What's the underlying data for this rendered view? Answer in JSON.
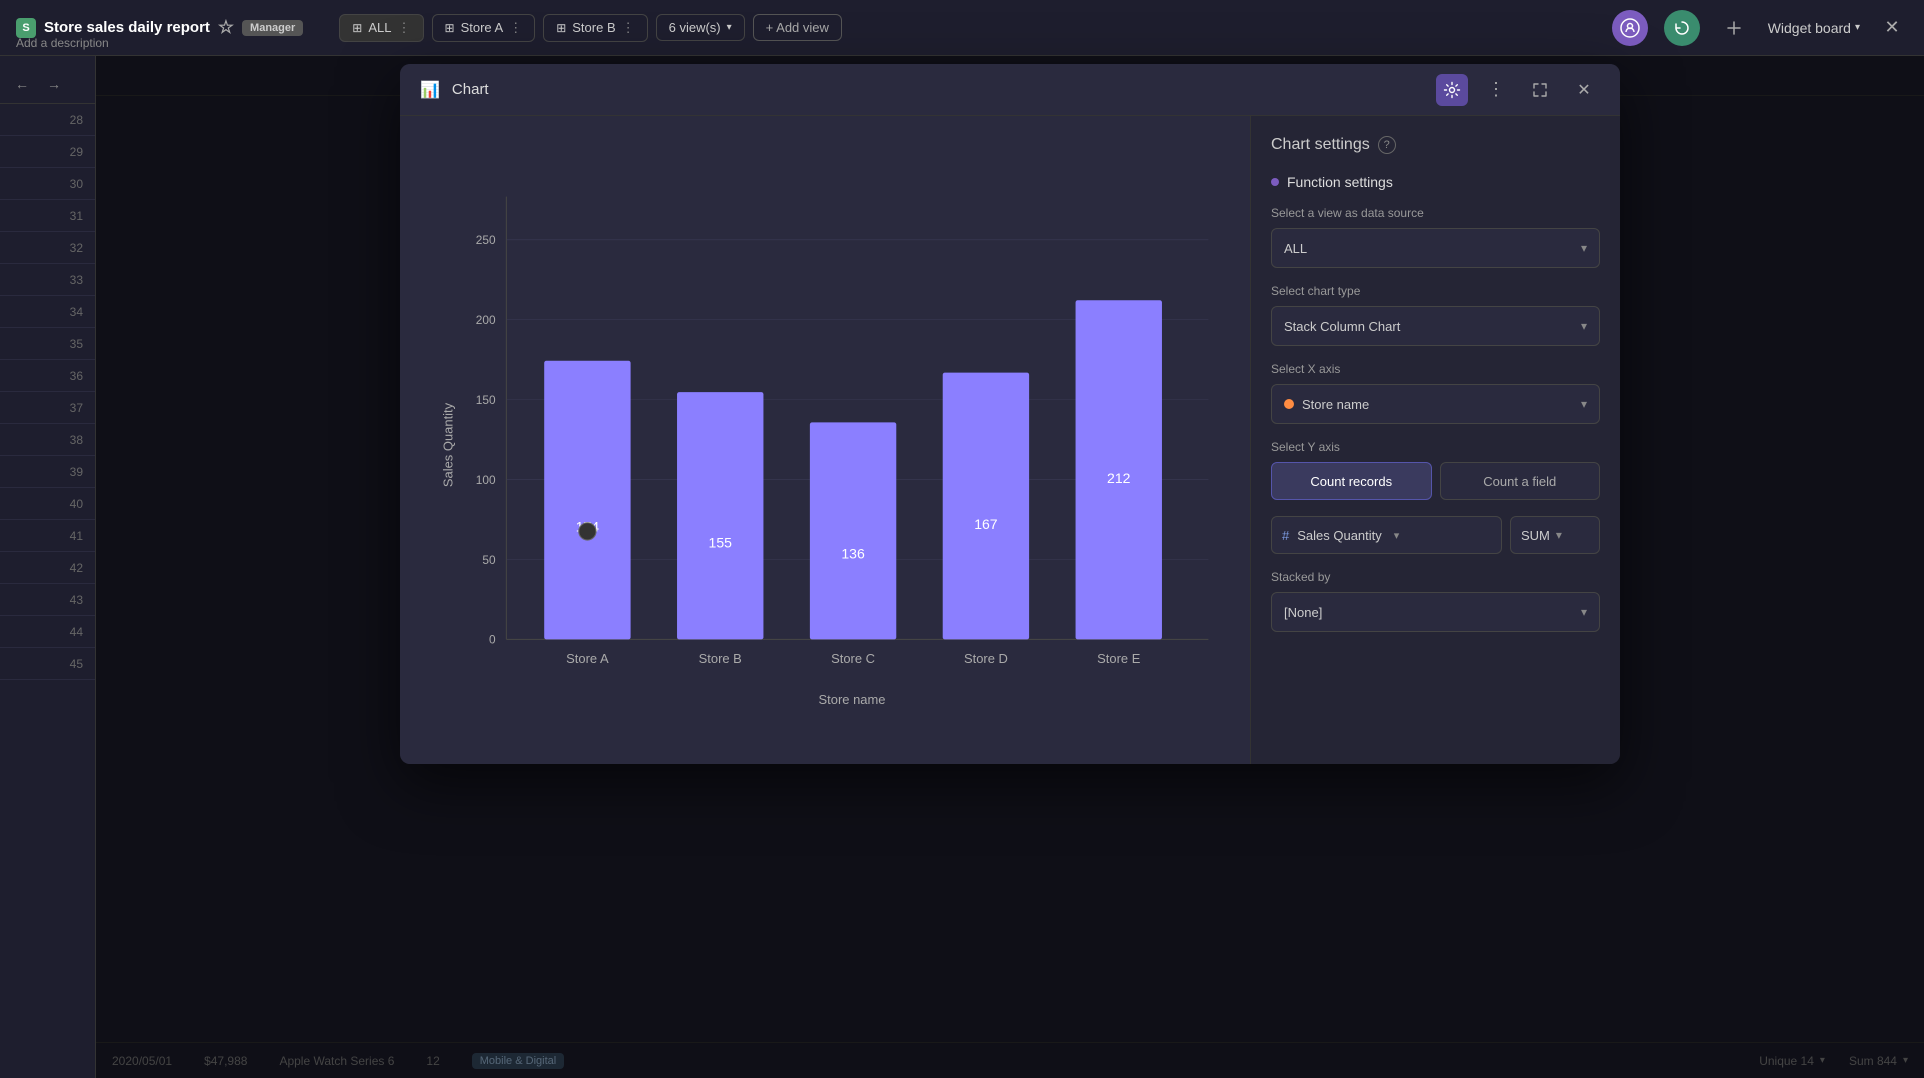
{
  "topbar": {
    "title": "Store sales daily report",
    "badge": "Manager",
    "description": "Add a description",
    "views": [
      {
        "label": "ALL",
        "icon": "grid"
      },
      {
        "label": "Store A",
        "icon": "grid"
      },
      {
        "label": "Store B",
        "icon": "grid"
      }
    ],
    "views_count": "6 view(s)",
    "add_view": "+ Add view",
    "widget_board": "Widget board"
  },
  "row_numbers": [
    28,
    29,
    30,
    31,
    32,
    33,
    34,
    35,
    36,
    37,
    38,
    39,
    40,
    41,
    42,
    43,
    44,
    45
  ],
  "modal": {
    "title": "Chart",
    "settings_title": "Chart settings",
    "function_settings": "Function settings",
    "data_source_label": "Select a view as data source",
    "data_source_value": "ALL",
    "chart_type_label": "Select chart type",
    "chart_type_value": "Stack Column Chart",
    "x_axis_label": "Select X axis",
    "x_axis_value": "Store name",
    "y_axis_label": "Select Y axis",
    "count_records": "Count records",
    "count_field": "Count a field",
    "field_name": "Sales Quantity",
    "field_function": "SUM",
    "stacked_by_label": "Stacked by",
    "stacked_by_value": "[None]"
  },
  "chart": {
    "y_axis_label": "Sales Quantity",
    "x_axis_label": "Store name",
    "bars": [
      {
        "label": "Store A",
        "value": 174,
        "height_pct": 68
      },
      {
        "label": "Store B",
        "value": 155,
        "height_pct": 60
      },
      {
        "label": "Store C",
        "value": 136,
        "height_pct": 53
      },
      {
        "label": "Store D",
        "value": 167,
        "height_pct": 65
      },
      {
        "label": "Store E",
        "value": 212,
        "height_pct": 83
      }
    ],
    "y_ticks": [
      "0",
      "50",
      "100",
      "150",
      "200",
      "250"
    ],
    "color": "#8b7fff"
  },
  "bottombar": {
    "date": "2020/05/01",
    "amount": "$47,988",
    "product": "Apple Watch Series 6",
    "number": "12",
    "category": "Mobile & Digital",
    "unique": "Unique 14",
    "sum": "Sum 844"
  }
}
